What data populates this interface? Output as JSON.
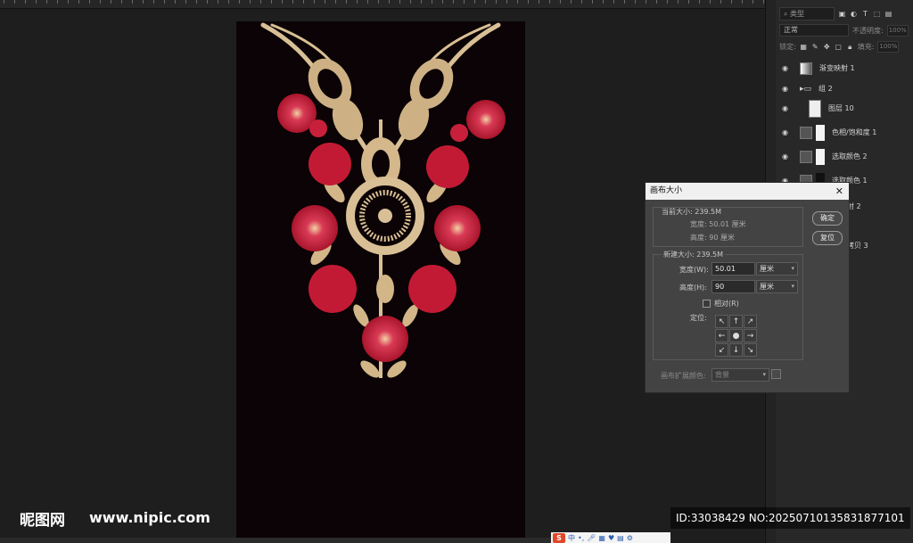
{
  "layers_panel": {
    "filter_label": "类型",
    "blend_mode": "正常",
    "opacity_label": "不透明度:",
    "opacity_value": "100%",
    "lock_label": "锁定:",
    "fill_label": "填充:",
    "fill_value": "100%",
    "layers": [
      {
        "name": "渐变映射 1"
      },
      {
        "name": "组 2"
      },
      {
        "name": "图层 10"
      },
      {
        "name": "色相/饱和度 1"
      },
      {
        "name": "选取颜色 2"
      },
      {
        "name": "选取颜色 1"
      },
      {
        "name": "射 2"
      },
      {
        "name": "拷贝 3"
      }
    ]
  },
  "dialog": {
    "title": "画布大小",
    "current_size_label": "当前大小: 239.5M",
    "current_width": "宽度:  50.01 厘米",
    "current_height": "高度:  90 厘米",
    "new_size_label": "新建大小: 239.5M",
    "width_label": "宽度(W):",
    "width_value": "50.01",
    "width_unit": "厘米",
    "height_label": "高度(H):",
    "height_value": "90",
    "height_unit": "厘米",
    "relative_label": "相对(R)",
    "anchor_label": "定位:",
    "anchor_arrows": [
      "↖",
      "↑",
      "↗",
      "←",
      "●",
      "→",
      "↙",
      "↓",
      "↘"
    ],
    "ext_color_label": "画布扩展颜色:",
    "ext_color_value": "背景",
    "ok_button": "确定",
    "reset_button": "复位"
  },
  "watermark": {
    "logo": "昵图网",
    "url": "www.nipic.com",
    "id_text": "ID:33038429 NO:20250710135831877101"
  },
  "ime_toolbar": {
    "logo": "S",
    "mode": "中"
  },
  "colors": {
    "canvas_bg": "#0b0305",
    "gold": "#d9bf95",
    "red": "#c8203a"
  }
}
